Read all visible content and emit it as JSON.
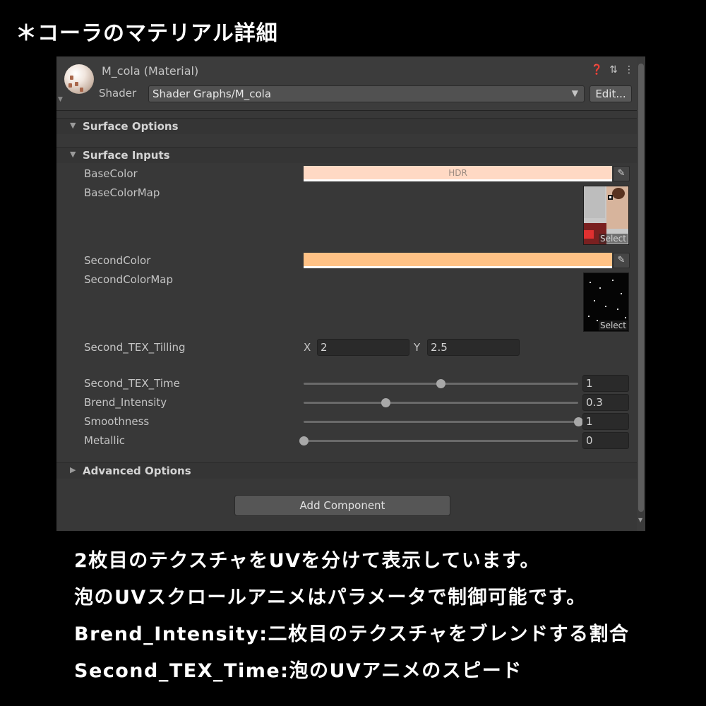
{
  "page_heading": "＊コーラのマテリアル詳細",
  "header": {
    "material_title": "M_cola (Material)",
    "shader_label": "Shader",
    "shader_value": "Shader Graphs/M_cola",
    "edit_label": "Edit..."
  },
  "sections": {
    "surface_options": "Surface Options",
    "surface_inputs": "Surface Inputs",
    "advanced_options": "Advanced Options"
  },
  "properties": {
    "base_color": {
      "label": "BaseColor",
      "hdr": "HDR",
      "color": "#ffd9c4"
    },
    "base_color_map": {
      "label": "BaseColorMap",
      "select": "Select"
    },
    "second_color": {
      "label": "SecondColor",
      "color": "#ffc286"
    },
    "second_color_map": {
      "label": "SecondColorMap",
      "select": "Select"
    },
    "second_tex_tilling": {
      "label": "Second_TEX_Tilling",
      "x_label": "X",
      "x": "2",
      "y_label": "Y",
      "y": "2.5"
    },
    "second_tex_time": {
      "label": "Second_TEX_Time",
      "value": "1",
      "fraction": 0.5
    },
    "brend_intensity": {
      "label": "Brend_Intensity",
      "value": "0.3",
      "fraction": 0.3
    },
    "smoothness": {
      "label": "Smoothness",
      "value": "1",
      "fraction": 1.0
    },
    "metallic": {
      "label": "Metallic",
      "value": "0",
      "fraction": 0.0
    }
  },
  "add_component": "Add Component",
  "description": [
    "2枚目のテクスチャをUVを分けて表示しています。",
    "泡のUVスクロールアニメはパラメータで制御可能です。",
    "Brend_Intensity:二枚目のテクスチャをブレンドする割合",
    "Second_TEX_Time:泡のUVアニメのスピード"
  ],
  "icons": [
    "material-sphere-icon",
    "help-icon",
    "preset-icon",
    "kebab-menu-icon",
    "dropdown-arrow-icon",
    "eyedropper-icon",
    "foldout-icon"
  ]
}
